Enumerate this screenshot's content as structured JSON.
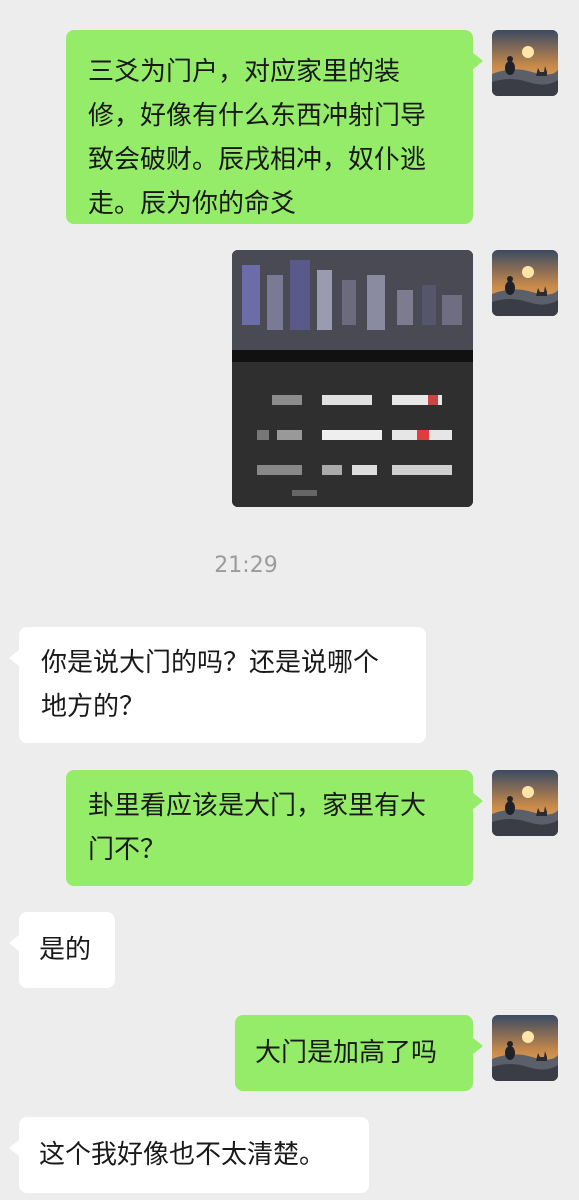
{
  "chat": {
    "timestamp": "21:29",
    "messages": [
      {
        "side": "me",
        "text": "三爻为门户，对应家里的装修，好像有什么东西冲射门导致会破财。辰戌相冲，奴仆逃走。辰为你的命爻"
      },
      {
        "side": "me",
        "type": "image",
        "text": ""
      },
      {
        "side": "them",
        "text": "你是说大门的吗？还是说哪个地方的？"
      },
      {
        "side": "me",
        "text": "卦里看应该是大门，家里有大门不？"
      },
      {
        "side": "them",
        "text": "是的"
      },
      {
        "side": "me",
        "text": "大门是加高了吗"
      },
      {
        "side": "them",
        "text": "这个我好像也不太清楚。"
      }
    ]
  },
  "colors": {
    "background": "#ededed",
    "my_bubble": "#95ec69",
    "their_bubble": "#ffffff",
    "timestamp_text": "#9b9b9b"
  },
  "icons": {
    "avatar": "avatar-meditation-sunset-icon"
  }
}
